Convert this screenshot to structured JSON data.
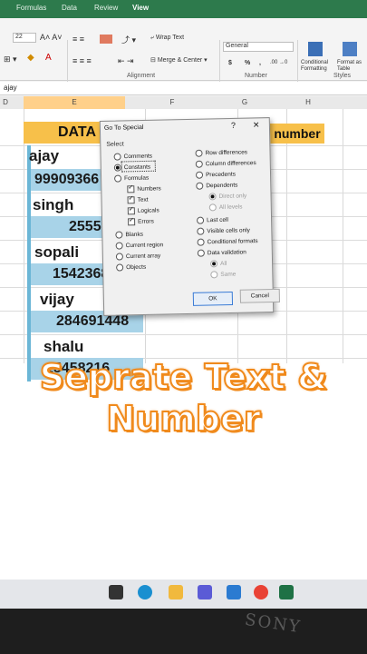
{
  "ribbon": {
    "tabs": [
      "Formulas",
      "Data",
      "Review",
      "View"
    ],
    "font_size": "22",
    "wrap_text": "Wrap Text",
    "merge_center": "Merge & Center",
    "number_format": "General",
    "currency": "$",
    "percent": "%",
    "comma": ",",
    "conditional_formatting": "Conditional Formatting",
    "format_as_table": "Format as Table",
    "alignment_label": "Alignment",
    "number_label": "Number",
    "styles_label": "Styles"
  },
  "name_box": "ajay",
  "columns": [
    "D",
    "E",
    "F",
    "G",
    "H"
  ],
  "sheet": {
    "header_data": "DATA",
    "header_number": "number",
    "cells": [
      "ajay",
      "99909366",
      "singh",
      "25559",
      "sopali",
      "1542368",
      "vijay",
      "284691448",
      "shalu",
      "15458216"
    ]
  },
  "dialog": {
    "title": "Go To Special",
    "help": "?",
    "close": "✕",
    "select_label": "Select",
    "left_options": [
      "Comments",
      "Constants",
      "Formulas",
      "Blanks",
      "Current region",
      "Current array",
      "Objects"
    ],
    "formula_subs": [
      "Numbers",
      "Text",
      "Logicals",
      "Errors"
    ],
    "right_options": [
      "Row differences",
      "Column differences",
      "Precedents",
      "Dependents",
      "Last cell",
      "Visible cells only",
      "Conditional formats",
      "Data validation"
    ],
    "dependents_subs": [
      "Direct only",
      "All levels"
    ],
    "validation_subs": [
      "All",
      "Same"
    ],
    "ok": "OK",
    "cancel": "Cancel",
    "selected_option": "Constants"
  },
  "caption": {
    "line1": "Seprate Text &",
    "line2": "Number"
  },
  "bezel_brand": "SONY",
  "colors": {
    "accent_orange": "#f08a1c",
    "header_yellow": "#f7c04a",
    "selection_blue": "#a8d3e8",
    "excel_green": "#2d7a4c"
  }
}
